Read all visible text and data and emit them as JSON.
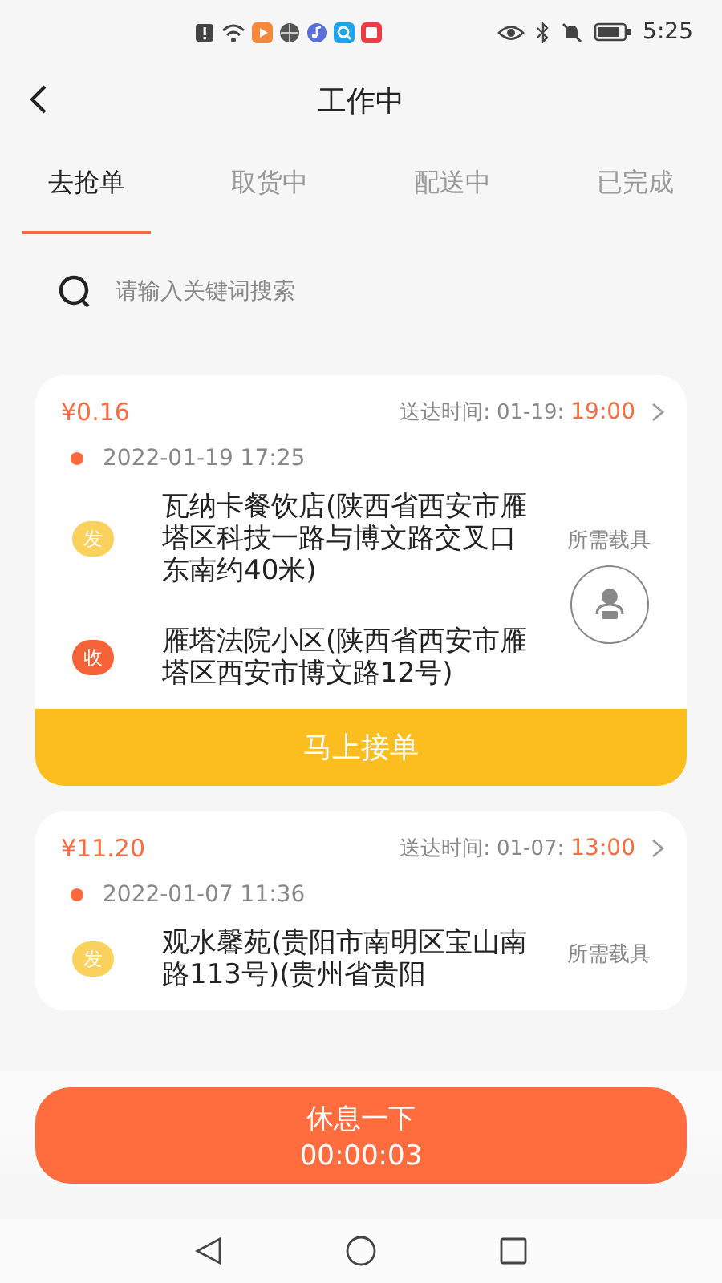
{
  "status_bar": {
    "time": "5:25"
  },
  "header": {
    "title": "工作中"
  },
  "tabs": [
    {
      "label": "去抢单",
      "selected": true
    },
    {
      "label": "取货中",
      "selected": false
    },
    {
      "label": "配送中",
      "selected": false
    },
    {
      "label": "已完成",
      "selected": false
    }
  ],
  "search": {
    "placeholder": "请输入关键词搜索"
  },
  "orders": [
    {
      "price": "¥0.16",
      "deadline_label": "送达时间:",
      "deadline_date": "01-19:",
      "deadline_time": "19:00",
      "created": "2022-01-19 17:25",
      "stops": [
        {
          "kind": "send",
          "badge": "发",
          "address": "瓦纳卡餐饮店(陕西省西安市雁塔区科技一路与博文路交叉口东南约40米)"
        },
        {
          "kind": "receive",
          "badge": "收",
          "address": "雁塔法院小区(陕西省西安市雁塔区西安市博文路12号)"
        }
      ],
      "vehicle_label": "所需载具",
      "vehicle_icon": true,
      "action": "马上接单"
    },
    {
      "price": "¥11.20",
      "deadline_label": "送达时间:",
      "deadline_date": "01-07:",
      "deadline_time": "13:00",
      "created": "2022-01-07 11:36",
      "stops": [
        {
          "kind": "send",
          "badge": "发",
          "address": "观水馨苑(贵阳市南明区宝山南路113号)(贵州省贵阳"
        }
      ],
      "vehicle_label": "所需载具",
      "vehicle_icon": false
    }
  ],
  "rest_button": {
    "label": "休息一下",
    "timer": "00:00:03"
  }
}
